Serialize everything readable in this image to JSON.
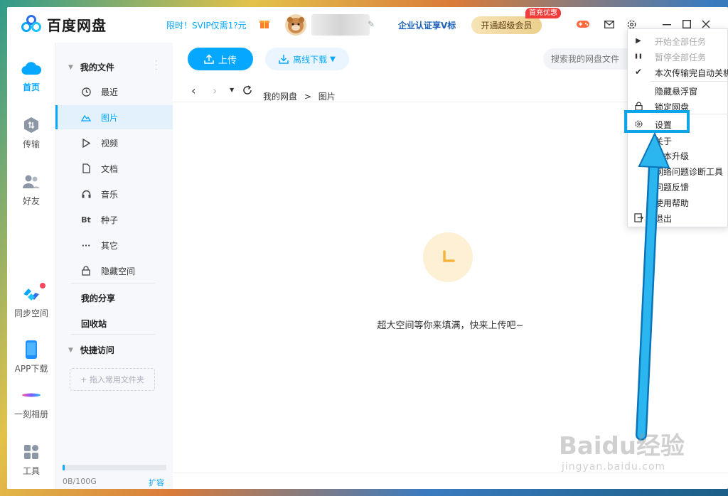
{
  "app": {
    "name": "百度网盘"
  },
  "header": {
    "promo": "限时！SVIP仅需1?元",
    "enterprise": "企业认证享V标",
    "vip_button": "开通超级会员",
    "vip_badge": "首充优惠"
  },
  "rail": {
    "items": [
      {
        "label": "首页"
      },
      {
        "label": "传输"
      },
      {
        "label": "好友"
      },
      {
        "label": "同步空间"
      },
      {
        "label": "APP下载"
      },
      {
        "label": "一刻相册"
      },
      {
        "label": "工具"
      }
    ]
  },
  "sidebar": {
    "my_files": "我的文件",
    "items": [
      {
        "label": "最近",
        "icon": "clock-icon"
      },
      {
        "label": "图片",
        "icon": "mountain-icon"
      },
      {
        "label": "视频",
        "icon": "play-icon"
      },
      {
        "label": "文档",
        "icon": "document-icon"
      },
      {
        "label": "音乐",
        "icon": "headphones-icon"
      },
      {
        "label": "种子",
        "icon": "bt-icon",
        "icon_text": "Bt"
      },
      {
        "label": "其它",
        "icon": "more-icon",
        "icon_text": "···"
      },
      {
        "label": "隐藏空间",
        "icon": "lock-icon"
      }
    ],
    "my_share": "我的分享",
    "recycle": "回收站",
    "quick_access": "快捷访问",
    "drop_hint": "+ 拖入常用文件夹",
    "quota": "0B/100G",
    "quota_used_fraction": 0.01,
    "expand": "扩容"
  },
  "main": {
    "upload": "上传",
    "offline": "离线下载",
    "search_placeholder": "搜索我的网盘文件",
    "breadcrumb": [
      "我的网盘",
      "图片"
    ],
    "empty_text": "超大空间等你来填满，快来上传吧~"
  },
  "menu": {
    "items": [
      {
        "label": "开始全部任务",
        "icon": "play-icon",
        "glyph": "▶",
        "disabled": true
      },
      {
        "label": "暂停全部任务",
        "icon": "pause-icon",
        "glyph": "❚❚",
        "disabled": true
      },
      {
        "label": "本次传输完自动关机",
        "icon": "check-icon",
        "glyph": "✔",
        "disabled": false
      },
      {
        "label": "隐藏悬浮窗",
        "icon": "",
        "glyph": "",
        "disabled": false
      },
      {
        "label": "锁定网盘",
        "icon": "lock-icon",
        "glyph": "",
        "disabled": false
      },
      {
        "label": "设置",
        "icon": "gear-icon",
        "glyph": "",
        "disabled": false
      },
      {
        "label": "关于",
        "icon": "",
        "glyph": "",
        "disabled": false
      },
      {
        "label": "版本升级",
        "icon": "",
        "glyph": "",
        "disabled": false
      },
      {
        "label": "网络问题诊断工具",
        "icon": "",
        "glyph": "",
        "disabled": false
      },
      {
        "label": "问题反馈",
        "icon": "",
        "glyph": "",
        "disabled": false
      },
      {
        "label": "使用帮助",
        "icon": "",
        "glyph": "",
        "disabled": false
      },
      {
        "label": "退出",
        "icon": "exit-icon",
        "glyph": "",
        "disabled": false
      }
    ]
  },
  "watermark": {
    "main": "Baidu经验",
    "sub": "jingyan.baidu.com"
  },
  "colors": {
    "accent": "#06a7ff",
    "annotation": "#0fa3e8"
  }
}
